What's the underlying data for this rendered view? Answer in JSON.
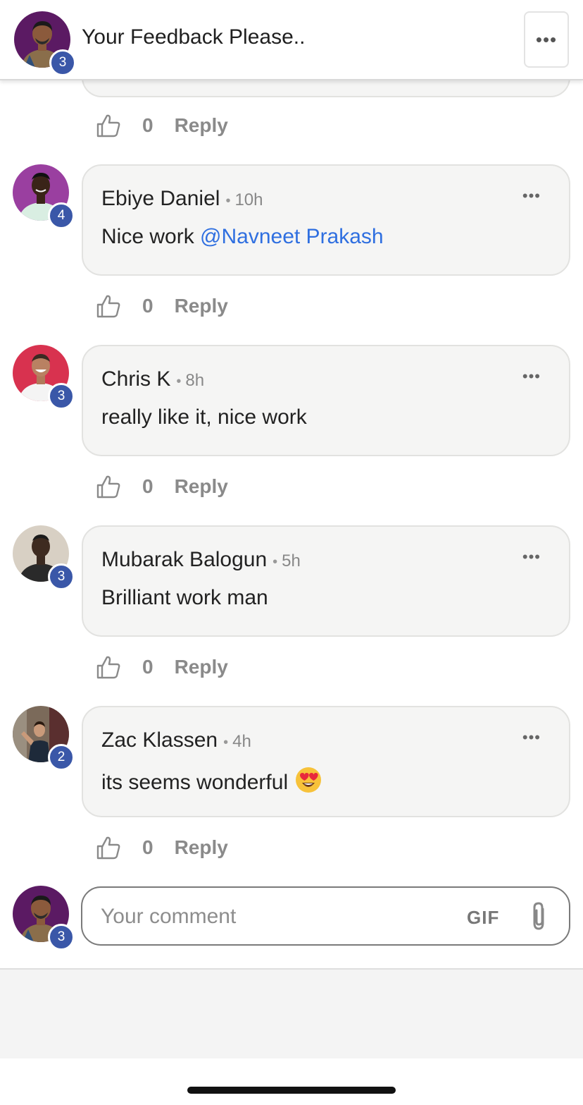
{
  "header": {
    "title": "Your Feedback Please..",
    "badge": "3",
    "menu_label": "•••"
  },
  "previous_comment": {
    "like_count": "0",
    "reply_label": "Reply"
  },
  "comments": [
    {
      "author": "Ebiye Daniel",
      "time": "10h",
      "text": "Nice work ",
      "mention": "@Navneet Prakash",
      "badge": "4",
      "like_count": "0",
      "reply_label": "Reply"
    },
    {
      "author": "Chris K",
      "time": "8h",
      "text": "really like it, nice work",
      "badge": "3",
      "like_count": "0",
      "reply_label": "Reply"
    },
    {
      "author": "Mubarak Balogun",
      "time": "5h",
      "text": "Brilliant work man",
      "badge": "3",
      "like_count": "0",
      "reply_label": "Reply"
    },
    {
      "author": "Zac Klassen",
      "time": "4h",
      "text": "its seems wonderful",
      "emoji": "heart-eyes-emoji",
      "badge": "2",
      "like_count": "0",
      "reply_label": "Reply"
    }
  ],
  "composer": {
    "placeholder": "Your comment",
    "gif_label": "GIF",
    "badge": "3"
  },
  "separator": "•",
  "more_label": "•••",
  "colors": {
    "badge": "#3a57a8",
    "mention": "#2f6fe0",
    "bubble": "#f5f5f4",
    "action_text": "#8a8a8a"
  }
}
